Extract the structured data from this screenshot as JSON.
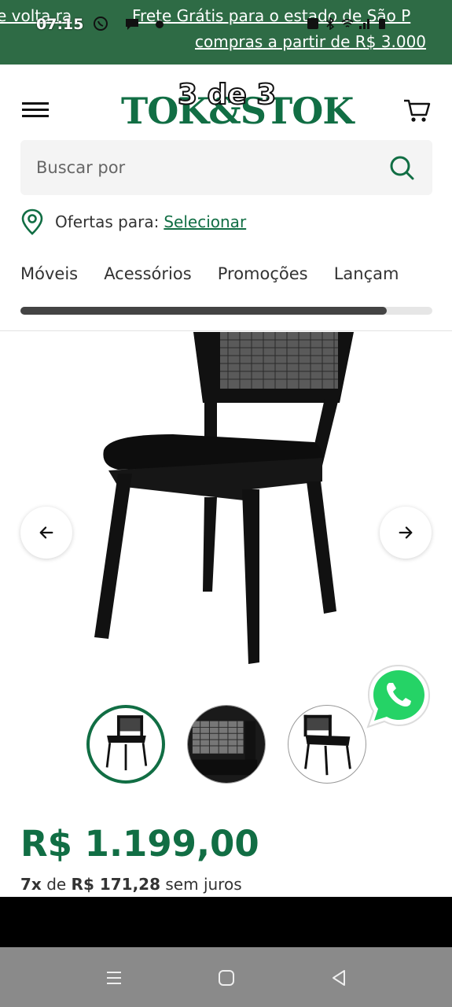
{
  "status_bar": {
    "time": "07:15"
  },
  "promo": {
    "left_fragment": "e volta ra",
    "line1": "Frete Grátis para o estado de São P",
    "line2": "compras a partir de R$ 3.000"
  },
  "header": {
    "logo": "TOK&STOK",
    "image_counter": "3 de 3"
  },
  "search": {
    "placeholder": "Buscar por"
  },
  "offers": {
    "label": "Ofertas para:",
    "link": "Selecionar"
  },
  "categories": [
    "Móveis",
    "Acessórios",
    "Promoções",
    "Lançam"
  ],
  "nav_scroll_progress": 0.89,
  "product": {
    "price": "R$ 1.199,00",
    "installments_count": "7x",
    "installments_mid": "de",
    "installments_value": "R$ 171,28",
    "installments_suffix": "sem juros"
  },
  "colors": {
    "brand_green": "#116e44",
    "promo_green": "#2e6b45",
    "whatsapp_green": "#25d366"
  },
  "icons": [
    "menu-icon",
    "cart-icon",
    "search-icon",
    "location-pin-icon",
    "arrow-left-icon",
    "arrow-right-icon",
    "whatsapp-icon",
    "android-menu-icon",
    "android-home-icon",
    "android-back-icon"
  ]
}
